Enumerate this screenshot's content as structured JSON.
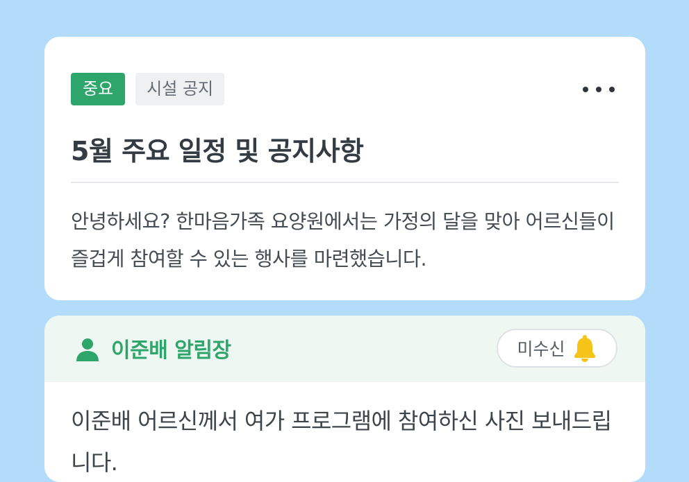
{
  "notice": {
    "tag_important": "중요",
    "tag_category": "시설 공지",
    "more_icon": "more-horizontal-icon",
    "title": "5월 주요 일정 및 공지사항",
    "body": "안녕하세요? 한마음가족 요양원에서는 가정의 달을 맞아 어르신들이 즐겁게 참여할 수 있는 행사를 마련했습니다."
  },
  "diary": {
    "icon": "person-icon",
    "name": "이준배 알림장",
    "status_label": "미수신",
    "status_icon": "bell-icon",
    "body": "이준배 어르신께서 여가 프로그램에 참여하신 사진 보내드립니다."
  },
  "colors": {
    "background": "#b3dcfb",
    "accent_green": "#2ea56a",
    "bell_yellow": "#f6c318"
  }
}
